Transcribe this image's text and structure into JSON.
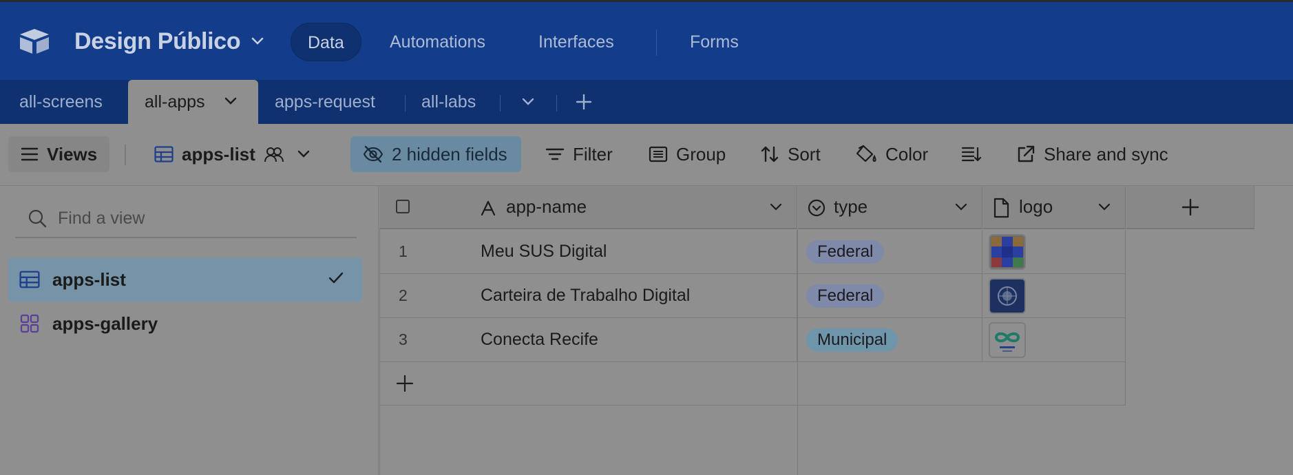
{
  "base": {
    "name": "Design Público",
    "logo_icon": "airtable-logo-icon"
  },
  "nav": [
    {
      "label": "Data",
      "active": true
    },
    {
      "label": "Automations",
      "active": false
    },
    {
      "label": "Interfaces",
      "active": false
    },
    {
      "label": "Forms",
      "active": false
    }
  ],
  "tables": [
    {
      "label": "all-screens",
      "active": false
    },
    {
      "label": "all-apps",
      "active": true
    },
    {
      "label": "apps-request",
      "active": false
    },
    {
      "label": "all-labs",
      "active": false
    }
  ],
  "toolbar": {
    "views_label": "Views",
    "current_view": "apps-list",
    "hidden_fields": "2 hidden fields",
    "filter": "Filter",
    "group": "Group",
    "sort": "Sort",
    "color": "Color",
    "share": "Share and sync"
  },
  "sidebar": {
    "search_placeholder": "Find a view",
    "views": [
      {
        "label": "apps-list",
        "icon": "grid-view-icon",
        "active": true
      },
      {
        "label": "apps-gallery",
        "icon": "gallery-view-icon",
        "active": false
      }
    ]
  },
  "grid": {
    "columns": [
      {
        "label": "app-name",
        "icon": "text-field-icon"
      },
      {
        "label": "type",
        "icon": "single-select-icon"
      },
      {
        "label": "logo",
        "icon": "attachment-icon"
      }
    ],
    "rows": [
      {
        "num": "1",
        "name": "Meu SUS Digital",
        "type": "Federal",
        "logo": "sus-logo"
      },
      {
        "num": "2",
        "name": "Carteira de Trabalho Digital",
        "type": "Federal",
        "logo": "ctps-logo"
      },
      {
        "num": "3",
        "name": "Conecta Recife",
        "type": "Municipal",
        "logo": "conecta-logo"
      }
    ]
  },
  "colors": {
    "topbar": "#133d8b",
    "tabbar": "#0f3170",
    "hidden_fields_bg": "#6a8aa1",
    "federal_pill": "#7f8aaa",
    "municipal_pill": "#6f95ab"
  }
}
